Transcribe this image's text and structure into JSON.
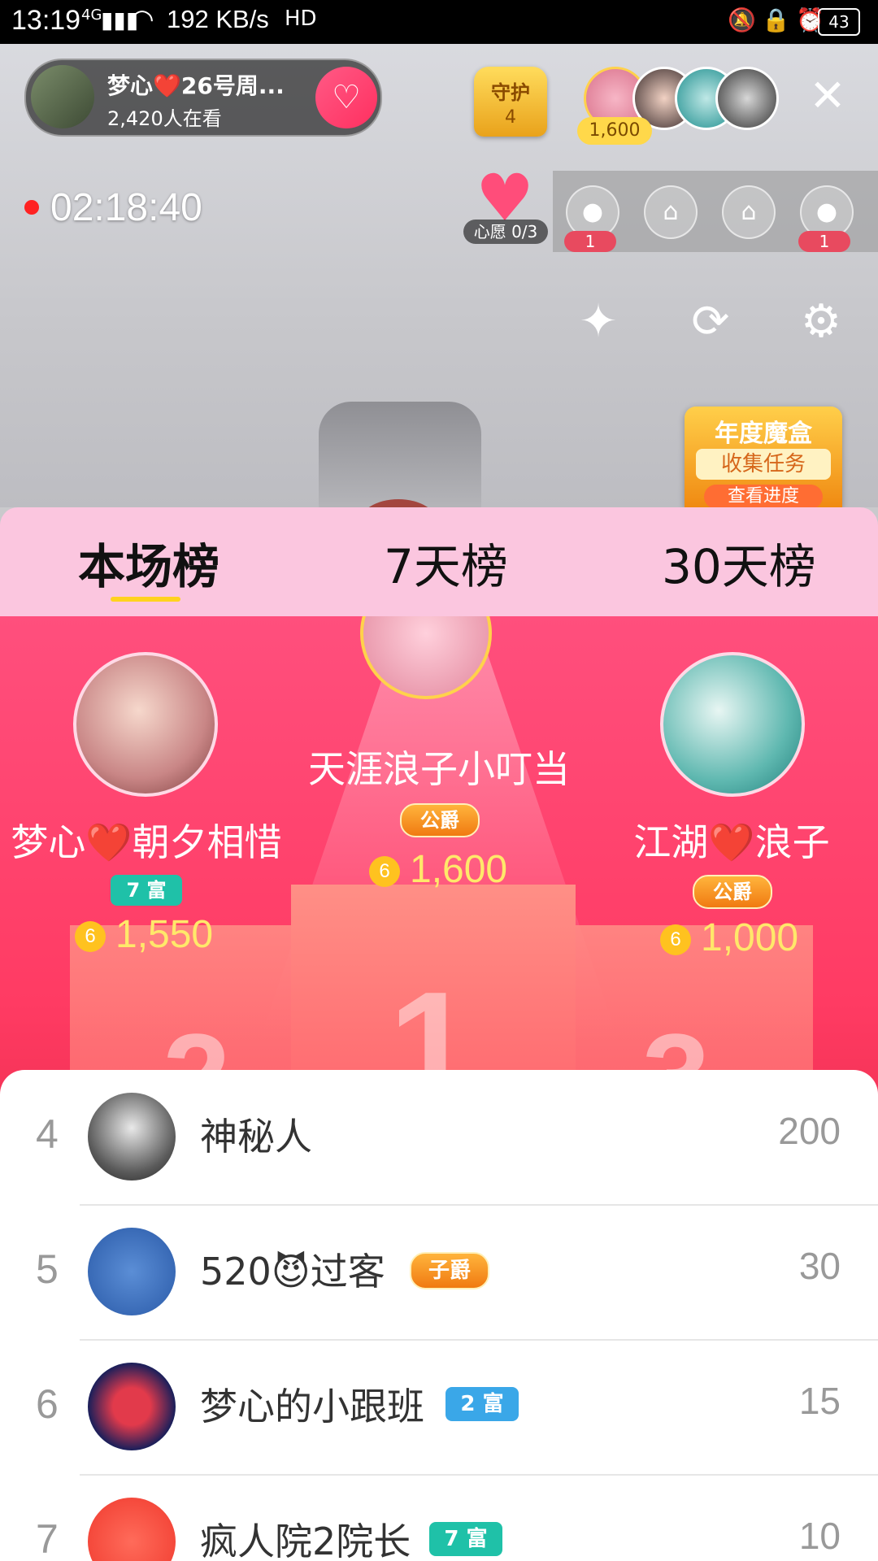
{
  "status_bar": {
    "time": "13:19",
    "signal": "4G",
    "speed": "192 KB/s",
    "battery": "43"
  },
  "live": {
    "host_name": "梦心❤️26号周...",
    "viewers": "2,420人在看",
    "guard_label": "守护",
    "guard_count": "4",
    "top_coin": "1,600",
    "timer": "02:18:40",
    "wish_label": "心愿 0/3",
    "seats": [
      {
        "badge": "1"
      },
      {
        "badge": ""
      },
      {
        "badge": ""
      },
      {
        "badge": "1"
      }
    ],
    "magic_box": {
      "title": "年度魔盒",
      "subtitle": "收集任务",
      "button": "查看进度"
    }
  },
  "tabs": [
    {
      "label": "本场榜"
    },
    {
      "label": "7天榜"
    },
    {
      "label": "30天榜"
    }
  ],
  "podium": [
    {
      "rank": "1",
      "name": "天涯浪子小叮当",
      "badge": "公爵",
      "coins": "1,600"
    },
    {
      "rank": "2",
      "name": "梦心❤️朝夕相惜",
      "badge": "7 富",
      "coins": "1,550"
    },
    {
      "rank": "3",
      "name": "江湖❤️浪子",
      "badge": "公爵",
      "coins": "1,000"
    }
  ],
  "list": [
    {
      "rank": "4",
      "name": "神秘人",
      "badge": "",
      "score": "200"
    },
    {
      "rank": "5",
      "name": "520😈过客",
      "badge": "子爵",
      "score": "30"
    },
    {
      "rank": "6",
      "name": "梦心的小跟班",
      "badge": "2 富",
      "score": "15"
    },
    {
      "rank": "7",
      "name": "疯人院2院长",
      "badge": "7 富",
      "score": "10"
    }
  ],
  "colors": {
    "tab_bg": "#fbc6df",
    "podium_bg": "#ff4f7d",
    "coin": "#ffe86a",
    "duke_badge": "#f07a11",
    "rich_badge": "#1fc1a8",
    "rich2_badge": "#3aa7e8"
  }
}
